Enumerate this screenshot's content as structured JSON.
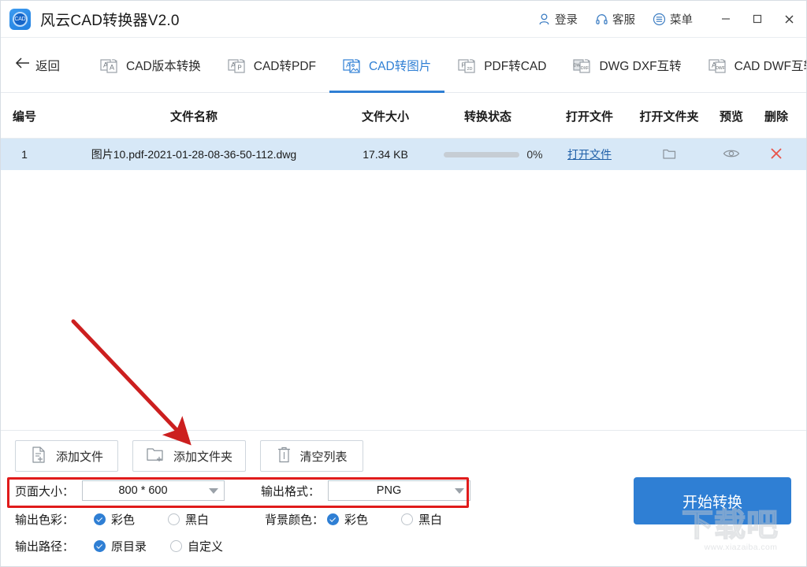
{
  "window": {
    "title": "风云CAD转换器V2.0",
    "logo_text": "CAD",
    "login_label": "登录",
    "support_label": "客服",
    "menu_label": "菜单",
    "minimize_label": "最小化",
    "maximize_label": "最大化",
    "close_label": "关闭"
  },
  "nav": {
    "back_label": "返回",
    "tabs": [
      {
        "label": "CAD版本转换",
        "active": false
      },
      {
        "label": "CAD转PDF",
        "active": false
      },
      {
        "label": "CAD转图片",
        "active": true
      },
      {
        "label": "PDF转CAD",
        "active": false
      },
      {
        "label": "DWG DXF互转",
        "active": false
      },
      {
        "label": "CAD DWF互转",
        "active": false
      }
    ]
  },
  "table": {
    "headers": [
      "编号",
      "文件名称",
      "文件大小",
      "转换状态",
      "打开文件",
      "打开文件夹",
      "预览",
      "删除"
    ],
    "rows": [
      {
        "index": "1",
        "filename": "图片10.pdf-2021-01-28-08-36-50-112.dwg",
        "filesize": "17.34 KB",
        "progress_pct": "0%",
        "progress_value": 0,
        "open_file_label": "打开文件",
        "open_folder_icon": "folder-icon",
        "preview_icon": "eye-icon",
        "delete_icon": "close-icon"
      }
    ]
  },
  "toolbar": {
    "add_file_label": "添加文件",
    "add_folder_label": "添加文件夹",
    "clear_list_label": "清空列表"
  },
  "settings": {
    "page_size_label": "页面大小：",
    "page_size_value": "800 * 600",
    "output_format_label": "输出格式：",
    "output_format_value": "PNG",
    "output_color_label": "输出色彩：",
    "output_color_options": [
      {
        "label": "彩色",
        "selected": true
      },
      {
        "label": "黑白",
        "selected": false
      }
    ],
    "background_color_label": "背景颜色：",
    "background_color_options": [
      {
        "label": "彩色",
        "selected": true
      },
      {
        "label": "黑白",
        "selected": false
      }
    ],
    "output_path_label": "输出路径：",
    "output_path_options": [
      {
        "label": "原目录",
        "selected": true
      },
      {
        "label": "自定义",
        "selected": false
      }
    ]
  },
  "action": {
    "start_label": "开始转换"
  },
  "watermark": {
    "text": "下载吧",
    "url": "www.xiazaiba.com"
  },
  "colors": {
    "accent": "#2f7fd4",
    "row_selected": "#d7e8f7",
    "annotation_red": "#e01b1b",
    "delete_red": "#e8544a"
  }
}
